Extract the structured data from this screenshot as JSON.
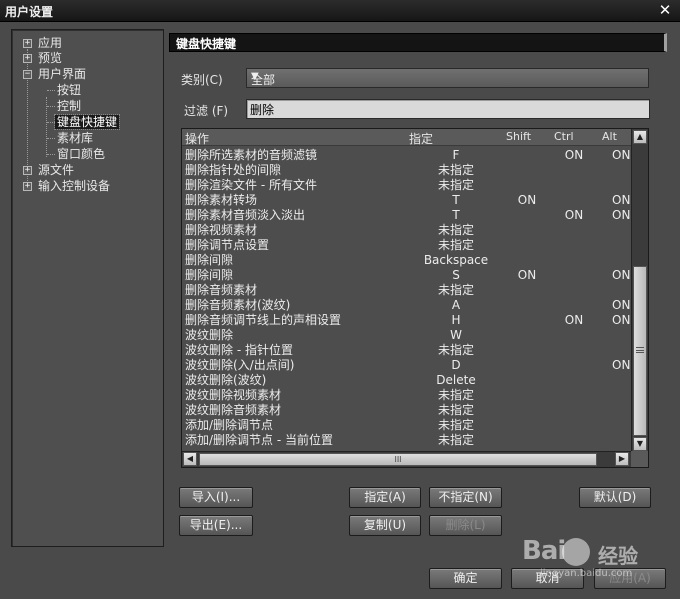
{
  "window": {
    "title": "用户设置",
    "close_icon": "close-icon"
  },
  "tree": {
    "items": [
      {
        "label": "应用",
        "level": 0,
        "expander": "+"
      },
      {
        "label": "预览",
        "level": 0,
        "expander": "+"
      },
      {
        "label": "用户界面",
        "level": 0,
        "expander": "−"
      },
      {
        "label": "按钮",
        "level": 1
      },
      {
        "label": "控制",
        "level": 1
      },
      {
        "label": "键盘快捷键",
        "level": 1,
        "selected": true
      },
      {
        "label": "素材库",
        "level": 1
      },
      {
        "label": "窗口颜色",
        "level": 1
      },
      {
        "label": "源文件",
        "level": 0,
        "expander": "+"
      },
      {
        "label": "输入控制设备",
        "level": 0,
        "expander": "+"
      }
    ]
  },
  "section": {
    "title": "键盘快捷键"
  },
  "category": {
    "label": "类别(C)",
    "value": "全部"
  },
  "filter": {
    "label": "过滤 (F)",
    "value": "删除"
  },
  "table": {
    "headers": {
      "operation": "操作",
      "key": "指定",
      "shift": "Shift",
      "ctrl": "Ctrl",
      "alt": "Alt"
    },
    "rows": [
      {
        "op": "删除所选素材的音频滤镜",
        "key": "F",
        "shift": "",
        "ctrl": "ON",
        "alt": "ON"
      },
      {
        "op": "删除指针处的间隙",
        "key": "未指定",
        "shift": "",
        "ctrl": "",
        "alt": ""
      },
      {
        "op": "删除渲染文件 - 所有文件",
        "key": "未指定",
        "shift": "",
        "ctrl": "",
        "alt": ""
      },
      {
        "op": "删除素材转场",
        "key": "T",
        "shift": "ON",
        "ctrl": "",
        "alt": "ON"
      },
      {
        "op": "删除素材音频淡入淡出",
        "key": "T",
        "shift": "",
        "ctrl": "ON",
        "alt": "ON"
      },
      {
        "op": "删除视频素材",
        "key": "未指定",
        "shift": "",
        "ctrl": "",
        "alt": ""
      },
      {
        "op": "删除调节点设置",
        "key": "未指定",
        "shift": "",
        "ctrl": "",
        "alt": ""
      },
      {
        "op": "删除间隙",
        "key": "Backspace",
        "shift": "",
        "ctrl": "",
        "alt": ""
      },
      {
        "op": "删除间隙",
        "key": "S",
        "shift": "ON",
        "ctrl": "",
        "alt": "ON"
      },
      {
        "op": "删除音频素材",
        "key": "未指定",
        "shift": "",
        "ctrl": "",
        "alt": ""
      },
      {
        "op": "删除音频素材(波纹)",
        "key": "A",
        "shift": "",
        "ctrl": "",
        "alt": "ON"
      },
      {
        "op": "删除音频调节线上的声相设置",
        "key": "H",
        "shift": "",
        "ctrl": "ON",
        "alt": "ON"
      },
      {
        "op": "波纹删除",
        "key": "W",
        "shift": "",
        "ctrl": "",
        "alt": ""
      },
      {
        "op": "波纹删除 - 指针位置",
        "key": "未指定",
        "shift": "",
        "ctrl": "",
        "alt": ""
      },
      {
        "op": "波纹删除(入/出点间)",
        "key": "D",
        "shift": "",
        "ctrl": "",
        "alt": "ON"
      },
      {
        "op": "波纹删除(波纹)",
        "key": "Delete",
        "shift": "",
        "ctrl": "",
        "alt": ""
      },
      {
        "op": "波纹删除视频素材",
        "key": "未指定",
        "shift": "",
        "ctrl": "",
        "alt": ""
      },
      {
        "op": "波纹删除音频素材",
        "key": "未指定",
        "shift": "",
        "ctrl": "",
        "alt": ""
      },
      {
        "op": "添加/删除调节点",
        "key": "未指定",
        "shift": "",
        "ctrl": "",
        "alt": ""
      },
      {
        "op": "添加/删除调节点 - 当前位置",
        "key": "未指定",
        "shift": "",
        "ctrl": "",
        "alt": ""
      }
    ]
  },
  "buttons": {
    "import": "导入(I)...",
    "export": "导出(E)...",
    "assign": "指定(A)",
    "unassign": "不指定(N)",
    "copy": "复制(U)",
    "delete": "删除(L)",
    "default": "默认(D)",
    "ok": "确定",
    "cancel": "取消",
    "apply": "应用(A)"
  },
  "watermark": {
    "logo": "Bai",
    "text": "经验",
    "url": "jingyan.baidu.com"
  }
}
